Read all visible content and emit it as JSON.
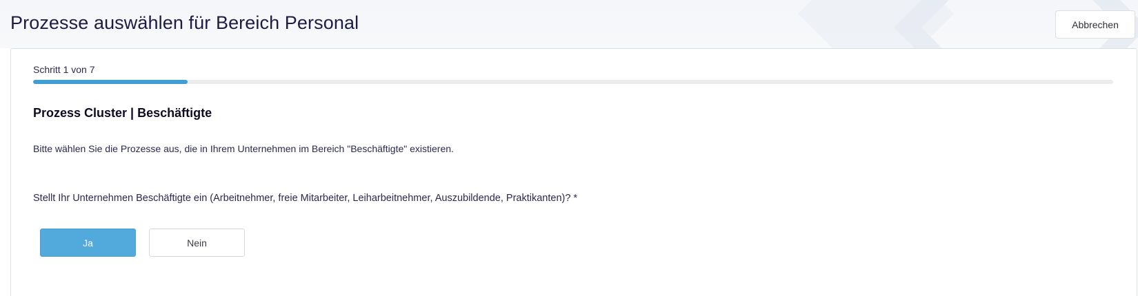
{
  "header": {
    "title": "Prozesse auswählen für Bereich Personal",
    "cancel_label": "Abbrechen"
  },
  "wizard": {
    "step_label": "Schritt 1 von 7",
    "current_step": 1,
    "total_steps": 7,
    "progress_fraction": 0.1429,
    "accent_color": "#52a9dc"
  },
  "section": {
    "title": "Prozess Cluster | Beschäftigte",
    "instruction": "Bitte wählen Sie die Prozesse aus, die in Ihrem Unternehmen im Bereich \"Beschäftigte\" existieren.",
    "question": "Stellt Ihr Unternehmen Beschäftigte ein (Arbeitnehmer, freie Mitarbeiter, Leiharbeitnehmer, Auszubildende, Praktikanten)? *"
  },
  "answers": {
    "yes_label": "Ja",
    "no_label": "Nein",
    "selected": "Ja"
  }
}
